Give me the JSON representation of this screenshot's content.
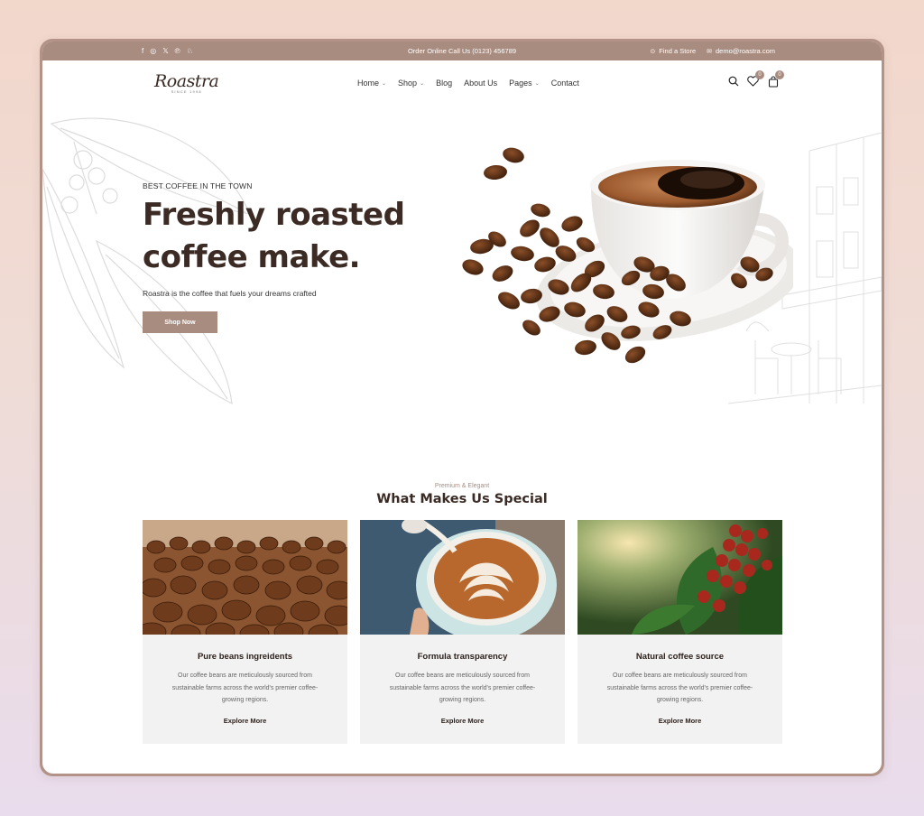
{
  "topbar": {
    "socials": [
      "facebook-icon",
      "instagram-icon",
      "x-icon",
      "pinterest-icon",
      "snapchat-icon"
    ],
    "center_text": "Order Online Call Us (0123) 456789",
    "find_store": "Find a Store",
    "email": "demo@roastra.com"
  },
  "header": {
    "brand": "Roastra",
    "since": "SINCE 1998",
    "menu": [
      {
        "label": "Home",
        "dropdown": true
      },
      {
        "label": "Shop",
        "dropdown": true
      },
      {
        "label": "Blog",
        "dropdown": false
      },
      {
        "label": "About Us",
        "dropdown": false
      },
      {
        "label": "Pages",
        "dropdown": true
      },
      {
        "label": "Contact",
        "dropdown": false
      }
    ],
    "wishlist_count": "0",
    "cart_count": "0"
  },
  "hero": {
    "eyebrow": "BEST COFFEE IN THE TOWN",
    "headline_line1": "Freshly roasted",
    "headline_line2": "coffee make.",
    "subtext": "Roastra is the coffee that fuels your dreams crafted",
    "button": "Shop Now"
  },
  "features": {
    "pretitle": "Premium & Elegant",
    "title": "What Makes Us Special",
    "cards": [
      {
        "title": "Pure beans ingreidents",
        "desc": "Our coffee beans are meticulously sourced from sustainable farms across the world's premier coffee-growing regions.",
        "link": "Explore More"
      },
      {
        "title": "Formula transparency",
        "desc": "Our coffee beans are meticulously sourced from sustainable farms across the world's premier coffee-growing regions.",
        "link": "Explore More"
      },
      {
        "title": "Natural coffee source",
        "desc": "Our coffee beans are meticulously sourced from sustainable farms across the world's premier coffee-growing regions.",
        "link": "Explore More"
      }
    ]
  },
  "colors": {
    "accent": "#a98c80",
    "heading": "#3b2b24",
    "card_bg": "#f3f2f2"
  }
}
